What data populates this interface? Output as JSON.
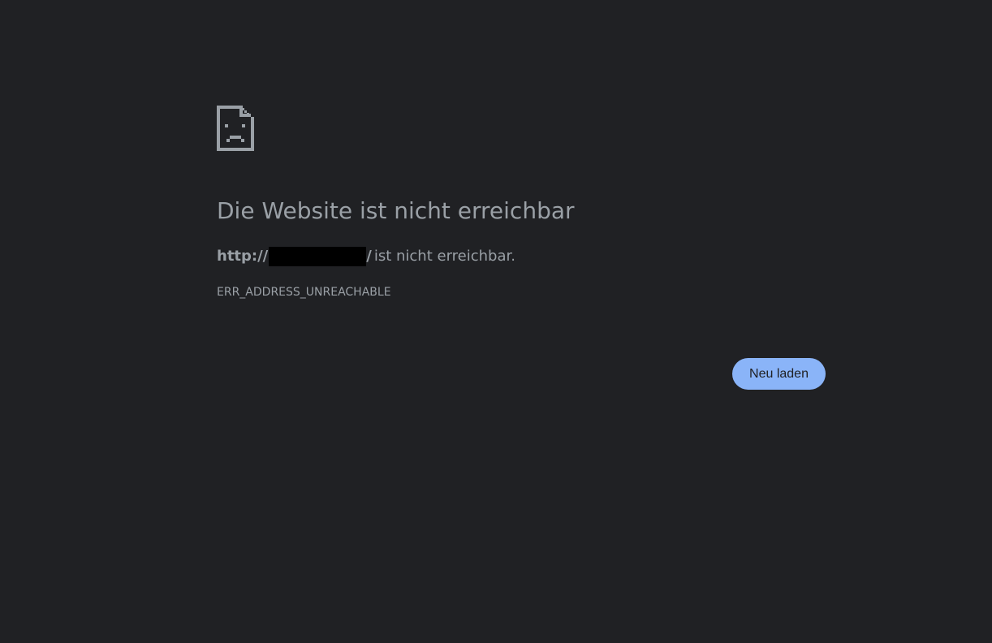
{
  "error_page": {
    "icon": "sad-document-icon",
    "headline": "Die Website ist nicht erreichbar",
    "summary": {
      "url_prefix": "http://",
      "url_suffix": "/",
      "rest": "ist nicht erreichbar."
    },
    "error_code": "ERR_ADDRESS_UNREACHABLE",
    "reload_label": "Neu laden"
  },
  "colors": {
    "background": "#202124",
    "text": "#9aa0a6",
    "button": "#8ab4f8",
    "button_text": "#202124",
    "redaction": "#000000"
  }
}
